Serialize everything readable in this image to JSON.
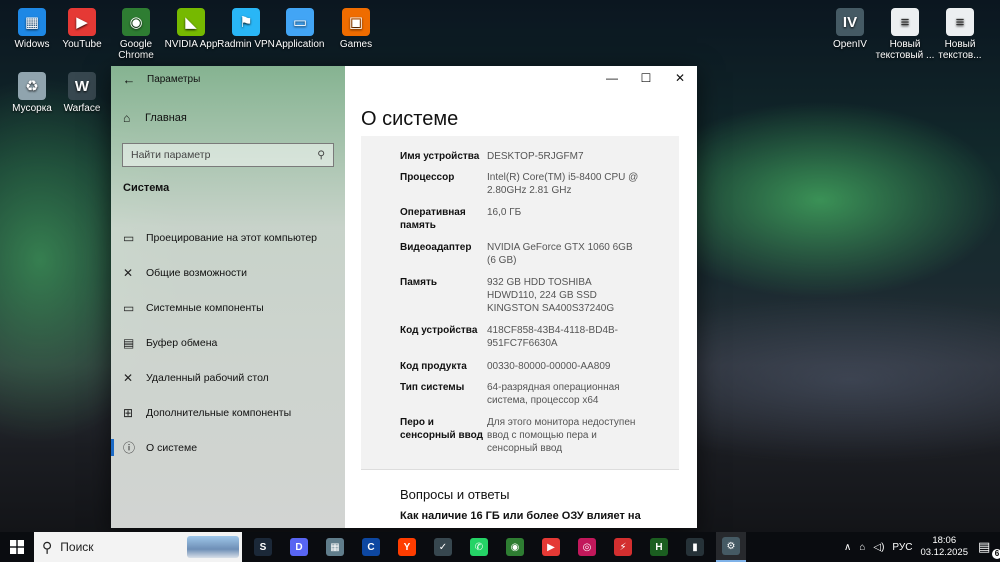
{
  "desktop": {
    "icons": [
      {
        "label": "Widows",
        "color": "#1e88e5",
        "glyph": "▦"
      },
      {
        "label": "YouTube",
        "color": "#e53935",
        "glyph": "▶"
      },
      {
        "label": "Google Chrome",
        "color": "#2e7d32",
        "glyph": "◉"
      },
      {
        "label": "NVIDIA App",
        "color": "#76b900",
        "glyph": "◣"
      },
      {
        "label": "Radmin VPN",
        "color": "#29b6f6",
        "glyph": "⚑"
      },
      {
        "label": "Application",
        "color": "#42a5f5",
        "glyph": "▭"
      },
      {
        "label": "Games",
        "color": "#ef6c00",
        "glyph": "▣"
      },
      {
        "label": "Мусорка",
        "color": "#90a4ae",
        "glyph": "♻"
      },
      {
        "label": "Warface",
        "color": "#37474f",
        "glyph": "W"
      },
      {
        "label": "OpenIV",
        "color": "#455a64",
        "glyph": "IV"
      },
      {
        "label": "Новый текстовый ...",
        "color": "#eceff1",
        "glyph": "≡"
      },
      {
        "label": "Новый текстов...",
        "color": "#eceff1",
        "glyph": "≡"
      }
    ]
  },
  "settings": {
    "window_title": "Параметры",
    "home_label": "Главная",
    "search_placeholder": "Найти параметр",
    "section_title": "Система",
    "nav_items": [
      {
        "label": "Проецирование на этот компьютер",
        "icon": "projector-icon"
      },
      {
        "label": "Общие возможности",
        "icon": "shared-icon"
      },
      {
        "label": "Системные компоненты",
        "icon": "components-icon"
      },
      {
        "label": "Буфер обмена",
        "icon": "clipboard-icon"
      },
      {
        "label": "Удаленный рабочий стол",
        "icon": "remote-desktop-icon"
      },
      {
        "label": "Дополнительные компоненты",
        "icon": "optional-features-icon"
      },
      {
        "label": "О системе",
        "icon": "info-icon"
      }
    ],
    "page_title": "О системе",
    "specs": [
      {
        "label": "Имя устройства",
        "value": "DESKTOP-5RJGFM7"
      },
      {
        "label": "Процессор",
        "value": "Intel(R) Core(TM) i5-8400 CPU @ 2.80GHz   2.81 GHz"
      },
      {
        "label": "Оперативная память",
        "value": "16,0 ГБ"
      },
      {
        "label": "Видеоадаптер",
        "value": "NVIDIA GeForce GTX 1060 6GB (6 GB)"
      },
      {
        "label": "Память",
        "value": "932 GB HDD TOSHIBA HDWD110, 224 GB SSD KINGSTON SA400S37240G"
      },
      {
        "label": "Код устройства",
        "value": "418CF858-43B4-4118-BD4B-951FC7F6630A"
      },
      {
        "label": "Код продукта",
        "value": "00330-80000-00000-AA809"
      },
      {
        "label": "Тип системы",
        "value": "64-разрядная операционная система, процессор x64"
      },
      {
        "label": "Перо и сенсорный ввод",
        "value": "Для этого монитора недоступен ввод с помощью пера и сенсорный ввод"
      }
    ],
    "faq_title": "Вопросы и ответы",
    "faq_question": "Как наличие 16 ГБ или более ОЗУ влияет на"
  },
  "taskbar": {
    "search_placeholder": "Поиск",
    "apps": [
      {
        "name": "steam-icon",
        "color": "#1b2838",
        "glyph": "S"
      },
      {
        "name": "discord-icon",
        "color": "#5865f2",
        "glyph": "D"
      },
      {
        "name": "store-icon",
        "color": "#607d8b",
        "glyph": "▦"
      },
      {
        "name": "app-icon",
        "color": "#0d47a1",
        "glyph": "C"
      },
      {
        "name": "yandex-browser-icon",
        "color": "#ff3d00",
        "glyph": "Y"
      },
      {
        "name": "app-icon",
        "color": "#37474f",
        "glyph": "✓"
      },
      {
        "name": "whatsapp-icon",
        "color": "#25d366",
        "glyph": "✆"
      },
      {
        "name": "chrome-icon",
        "color": "#2e7d32",
        "glyph": "◉"
      },
      {
        "name": "youtube-icon",
        "color": "#e53935",
        "glyph": "▶"
      },
      {
        "name": "instagram-icon",
        "color": "#c2185b",
        "glyph": "◎"
      },
      {
        "name": "app-icon",
        "color": "#d32f2f",
        "glyph": "⚡"
      },
      {
        "name": "app-icon",
        "color": "#1b5e20",
        "glyph": "H"
      },
      {
        "name": "app-icon",
        "color": "#263238",
        "glyph": "▮"
      },
      {
        "name": "settings-icon",
        "color": "#455a64",
        "glyph": "⚙"
      }
    ],
    "language": "РУС",
    "time": "18:06",
    "date": "03.12.2025",
    "notification_count": "6"
  }
}
